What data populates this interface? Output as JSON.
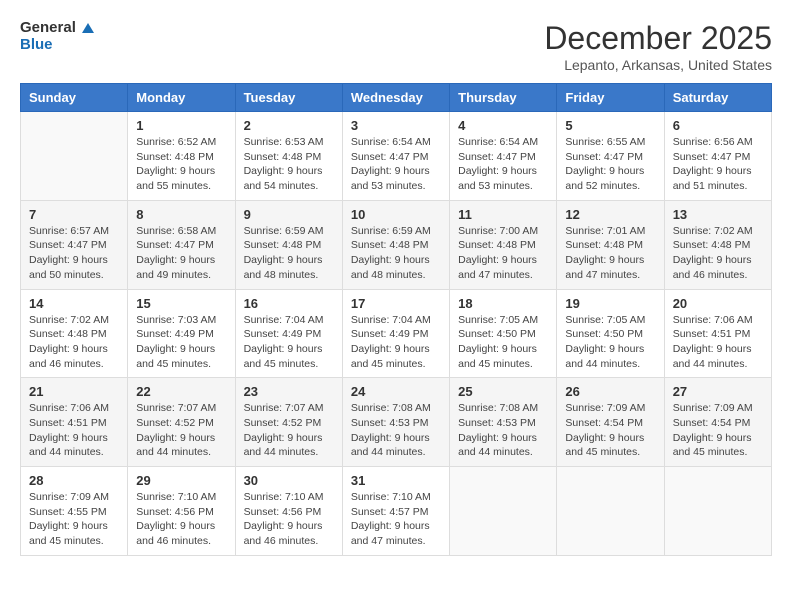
{
  "logo": {
    "line1": "General",
    "line2": "Blue"
  },
  "title": "December 2025",
  "subtitle": "Lepanto, Arkansas, United States",
  "weekdays": [
    "Sunday",
    "Monday",
    "Tuesday",
    "Wednesday",
    "Thursday",
    "Friday",
    "Saturday"
  ],
  "weeks": [
    [
      {
        "day": "",
        "sunrise": "",
        "sunset": "",
        "daylight": ""
      },
      {
        "day": "1",
        "sunrise": "Sunrise: 6:52 AM",
        "sunset": "Sunset: 4:48 PM",
        "daylight": "Daylight: 9 hours and 55 minutes."
      },
      {
        "day": "2",
        "sunrise": "Sunrise: 6:53 AM",
        "sunset": "Sunset: 4:48 PM",
        "daylight": "Daylight: 9 hours and 54 minutes."
      },
      {
        "day": "3",
        "sunrise": "Sunrise: 6:54 AM",
        "sunset": "Sunset: 4:47 PM",
        "daylight": "Daylight: 9 hours and 53 minutes."
      },
      {
        "day": "4",
        "sunrise": "Sunrise: 6:54 AM",
        "sunset": "Sunset: 4:47 PM",
        "daylight": "Daylight: 9 hours and 53 minutes."
      },
      {
        "day": "5",
        "sunrise": "Sunrise: 6:55 AM",
        "sunset": "Sunset: 4:47 PM",
        "daylight": "Daylight: 9 hours and 52 minutes."
      },
      {
        "day": "6",
        "sunrise": "Sunrise: 6:56 AM",
        "sunset": "Sunset: 4:47 PM",
        "daylight": "Daylight: 9 hours and 51 minutes."
      }
    ],
    [
      {
        "day": "7",
        "sunrise": "Sunrise: 6:57 AM",
        "sunset": "Sunset: 4:47 PM",
        "daylight": "Daylight: 9 hours and 50 minutes."
      },
      {
        "day": "8",
        "sunrise": "Sunrise: 6:58 AM",
        "sunset": "Sunset: 4:47 PM",
        "daylight": "Daylight: 9 hours and 49 minutes."
      },
      {
        "day": "9",
        "sunrise": "Sunrise: 6:59 AM",
        "sunset": "Sunset: 4:48 PM",
        "daylight": "Daylight: 9 hours and 48 minutes."
      },
      {
        "day": "10",
        "sunrise": "Sunrise: 6:59 AM",
        "sunset": "Sunset: 4:48 PM",
        "daylight": "Daylight: 9 hours and 48 minutes."
      },
      {
        "day": "11",
        "sunrise": "Sunrise: 7:00 AM",
        "sunset": "Sunset: 4:48 PM",
        "daylight": "Daylight: 9 hours and 47 minutes."
      },
      {
        "day": "12",
        "sunrise": "Sunrise: 7:01 AM",
        "sunset": "Sunset: 4:48 PM",
        "daylight": "Daylight: 9 hours and 47 minutes."
      },
      {
        "day": "13",
        "sunrise": "Sunrise: 7:02 AM",
        "sunset": "Sunset: 4:48 PM",
        "daylight": "Daylight: 9 hours and 46 minutes."
      }
    ],
    [
      {
        "day": "14",
        "sunrise": "Sunrise: 7:02 AM",
        "sunset": "Sunset: 4:48 PM",
        "daylight": "Daylight: 9 hours and 46 minutes."
      },
      {
        "day": "15",
        "sunrise": "Sunrise: 7:03 AM",
        "sunset": "Sunset: 4:49 PM",
        "daylight": "Daylight: 9 hours and 45 minutes."
      },
      {
        "day": "16",
        "sunrise": "Sunrise: 7:04 AM",
        "sunset": "Sunset: 4:49 PM",
        "daylight": "Daylight: 9 hours and 45 minutes."
      },
      {
        "day": "17",
        "sunrise": "Sunrise: 7:04 AM",
        "sunset": "Sunset: 4:49 PM",
        "daylight": "Daylight: 9 hours and 45 minutes."
      },
      {
        "day": "18",
        "sunrise": "Sunrise: 7:05 AM",
        "sunset": "Sunset: 4:50 PM",
        "daylight": "Daylight: 9 hours and 45 minutes."
      },
      {
        "day": "19",
        "sunrise": "Sunrise: 7:05 AM",
        "sunset": "Sunset: 4:50 PM",
        "daylight": "Daylight: 9 hours and 44 minutes."
      },
      {
        "day": "20",
        "sunrise": "Sunrise: 7:06 AM",
        "sunset": "Sunset: 4:51 PM",
        "daylight": "Daylight: 9 hours and 44 minutes."
      }
    ],
    [
      {
        "day": "21",
        "sunrise": "Sunrise: 7:06 AM",
        "sunset": "Sunset: 4:51 PM",
        "daylight": "Daylight: 9 hours and 44 minutes."
      },
      {
        "day": "22",
        "sunrise": "Sunrise: 7:07 AM",
        "sunset": "Sunset: 4:52 PM",
        "daylight": "Daylight: 9 hours and 44 minutes."
      },
      {
        "day": "23",
        "sunrise": "Sunrise: 7:07 AM",
        "sunset": "Sunset: 4:52 PM",
        "daylight": "Daylight: 9 hours and 44 minutes."
      },
      {
        "day": "24",
        "sunrise": "Sunrise: 7:08 AM",
        "sunset": "Sunset: 4:53 PM",
        "daylight": "Daylight: 9 hours and 44 minutes."
      },
      {
        "day": "25",
        "sunrise": "Sunrise: 7:08 AM",
        "sunset": "Sunset: 4:53 PM",
        "daylight": "Daylight: 9 hours and 44 minutes."
      },
      {
        "day": "26",
        "sunrise": "Sunrise: 7:09 AM",
        "sunset": "Sunset: 4:54 PM",
        "daylight": "Daylight: 9 hours and 45 minutes."
      },
      {
        "day": "27",
        "sunrise": "Sunrise: 7:09 AM",
        "sunset": "Sunset: 4:54 PM",
        "daylight": "Daylight: 9 hours and 45 minutes."
      }
    ],
    [
      {
        "day": "28",
        "sunrise": "Sunrise: 7:09 AM",
        "sunset": "Sunset: 4:55 PM",
        "daylight": "Daylight: 9 hours and 45 minutes."
      },
      {
        "day": "29",
        "sunrise": "Sunrise: 7:10 AM",
        "sunset": "Sunset: 4:56 PM",
        "daylight": "Daylight: 9 hours and 46 minutes."
      },
      {
        "day": "30",
        "sunrise": "Sunrise: 7:10 AM",
        "sunset": "Sunset: 4:56 PM",
        "daylight": "Daylight: 9 hours and 46 minutes."
      },
      {
        "day": "31",
        "sunrise": "Sunrise: 7:10 AM",
        "sunset": "Sunset: 4:57 PM",
        "daylight": "Daylight: 9 hours and 47 minutes."
      },
      {
        "day": "",
        "sunrise": "",
        "sunset": "",
        "daylight": ""
      },
      {
        "day": "",
        "sunrise": "",
        "sunset": "",
        "daylight": ""
      },
      {
        "day": "",
        "sunrise": "",
        "sunset": "",
        "daylight": ""
      }
    ]
  ]
}
